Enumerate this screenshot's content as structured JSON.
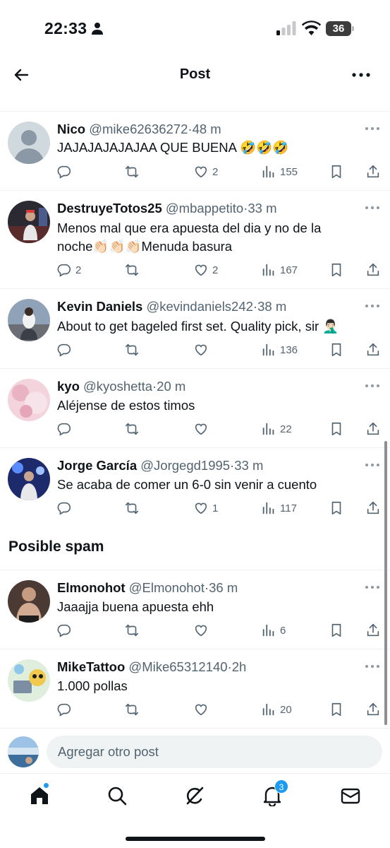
{
  "status_bar": {
    "time": "22:33",
    "battery": "36"
  },
  "header": {
    "title": "Post"
  },
  "replies": [
    {
      "name": "Nico",
      "handle": "@mike62636272",
      "sep": "·",
      "time": "48 m",
      "text": "JAJAJAJAJAJAA QUE BUENA 🤣🤣🤣",
      "replies": "",
      "likes": "2",
      "views": "155"
    },
    {
      "name": "DestruyeTotos25",
      "handle": "@mbappetito",
      "sep": "·",
      "time": "33 m",
      "text": "Menos mal que era apuesta del dia y no de la noche👏🏻👏🏻👏🏻Menuda basura",
      "replies": "2",
      "likes": "2",
      "views": "167"
    },
    {
      "name": "Kevin Daniels",
      "handle": "@kevindaniels242",
      "sep": "·",
      "time": "38 m",
      "text": "About to get bageled first set. Quality pick, sir 🤦🏻‍♂️",
      "replies": "",
      "likes": "",
      "views": "136"
    },
    {
      "name": "kyo",
      "handle": "@kyoshetta",
      "sep": "·",
      "time": "20 m",
      "text": "Aléjense de estos timos",
      "replies": "",
      "likes": "",
      "views": "22"
    },
    {
      "name": "Jorge García",
      "handle": "@Jorgegd1995",
      "sep": "·",
      "time": "33 m",
      "text": "Se acaba de comer un 6-0 sin venir a cuento",
      "replies": "",
      "likes": "1",
      "views": "117"
    }
  ],
  "spam_section": {
    "heading": "Posible spam"
  },
  "spam_replies": [
    {
      "name": "Elmonohot",
      "handle": "@Elmonohot",
      "sep": "·",
      "time": "36 m",
      "text": "Jaaajja buena apuesta ehh",
      "replies": "",
      "likes": "",
      "views": "6"
    },
    {
      "name": "MikeTattoo",
      "handle": "@Mike65312140",
      "sep": "·",
      "time": "2h",
      "text": "1.000 pollas",
      "replies": "",
      "likes": "",
      "views": "20"
    }
  ],
  "compose": {
    "placeholder": "Agregar otro post"
  },
  "tab_bar": {
    "notifications_badge": "3"
  },
  "colors": {
    "accent": "#1d9bf0",
    "text": "#0f1419",
    "muted": "#536471",
    "divider": "#eff3f4"
  }
}
